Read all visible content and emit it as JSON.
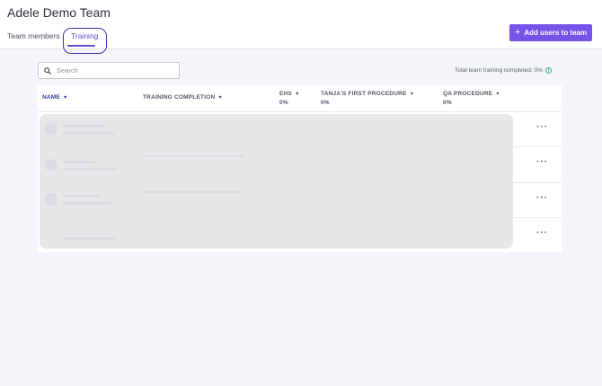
{
  "header": {
    "title": "Adele Demo Team",
    "tabs": [
      {
        "label": "Team members",
        "active": false
      },
      {
        "label": "Training",
        "active": true
      }
    ],
    "add_button": {
      "icon": "plus-icon",
      "label": "Add users to team"
    }
  },
  "colors": {
    "accent": "#7752e6",
    "active_tab": "#6a4cc9",
    "sort_header": "#2d3f9a",
    "info": "#3aa37d"
  },
  "search": {
    "icon": "search-icon",
    "placeholder": "Search",
    "value": ""
  },
  "summary": {
    "total_label": "Total team training completed: 0%",
    "icon": "info-icon"
  },
  "table": {
    "columns": [
      {
        "label": "NAME",
        "sort_icon": "caret-down-icon"
      },
      {
        "label": "TRAINING COMPLETION",
        "sort_icon": "caret-down-icon"
      },
      {
        "label": "EHS",
        "value": "0%",
        "sort_icon": "caret-down-icon"
      },
      {
        "label": "TANJA'S FIRST PROCEDURE",
        "value": "0%",
        "sort_icon": "caret-down-icon"
      },
      {
        "label": "QA PROCEDURE",
        "value": "0%",
        "sort_icon": "caret-down-icon"
      }
    ],
    "row_action": "···",
    "row_count": 4
  }
}
